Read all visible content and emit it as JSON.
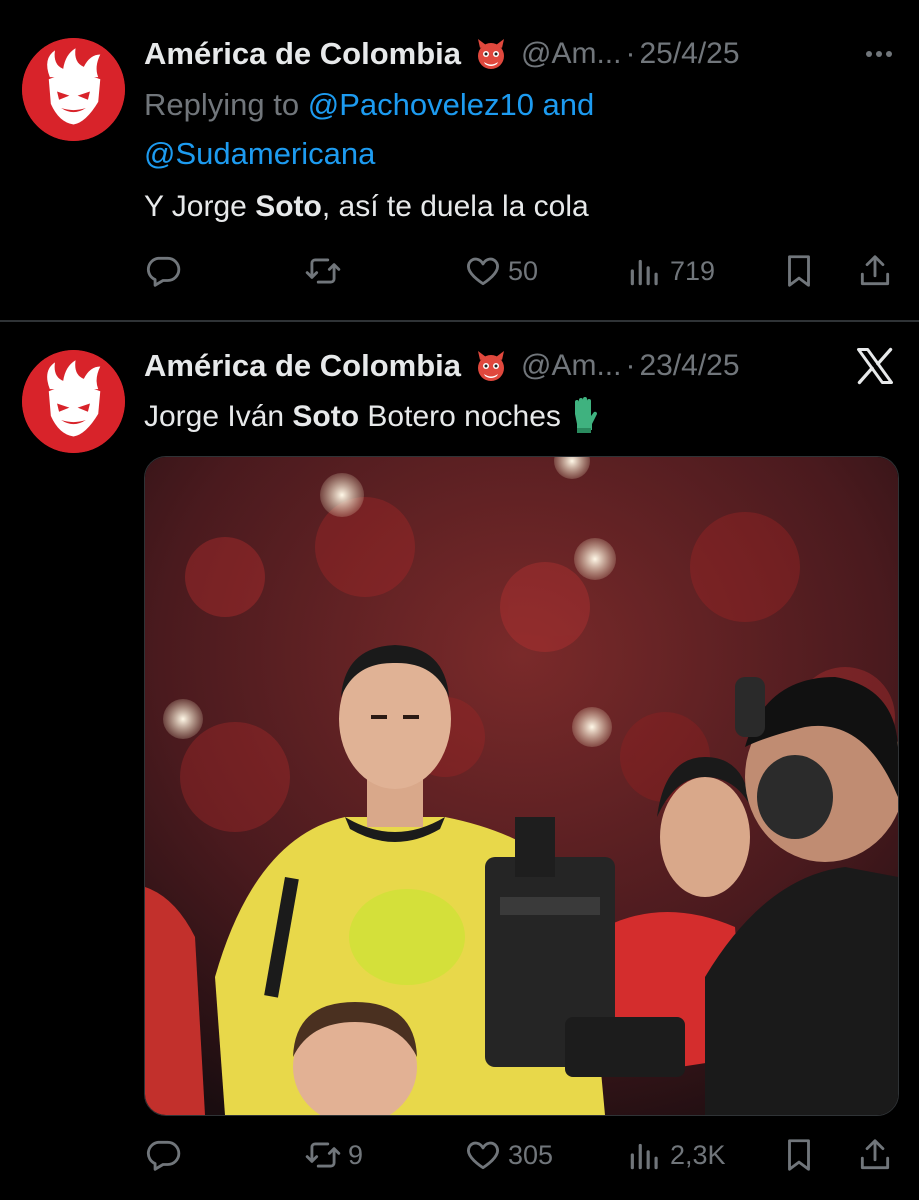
{
  "tweets": [
    {
      "author": {
        "name": "América de Colombia",
        "handle": "@Am...",
        "badge_icon": "devil-emoji-icon"
      },
      "separator": "·",
      "date": "25/4/25",
      "replying": {
        "prefix": "Replying to ",
        "mention1": "@Pachovelez10",
        "conjunction": " and",
        "mention2": "@Sudamericana"
      },
      "text": {
        "part1": "Y Jorge ",
        "bold": "Soto",
        "part2": ", así te duela la cola"
      },
      "actions": {
        "replies": "",
        "retweets": "",
        "likes": "50",
        "views": "719"
      }
    },
    {
      "author": {
        "name": "América de Colombia",
        "handle": "@Am...",
        "badge_icon": "devil-emoji-icon"
      },
      "separator": "·",
      "date": "23/4/25",
      "text": {
        "part1": "Jorge Iván ",
        "bold": "Soto",
        "part2": " Botero noches",
        "emoji_icon": "goalkeeper-glove-icon"
      },
      "media": {
        "kind": "photo"
      },
      "actions": {
        "replies": "",
        "retweets": "9",
        "likes": "305",
        "views": "2,3K"
      }
    }
  ],
  "colors": {
    "background": "#000000",
    "text": "#e7e9ea",
    "muted": "#71767b",
    "link": "#1d9bf0",
    "avatar": "#d8232a",
    "divider": "#2f3336"
  }
}
